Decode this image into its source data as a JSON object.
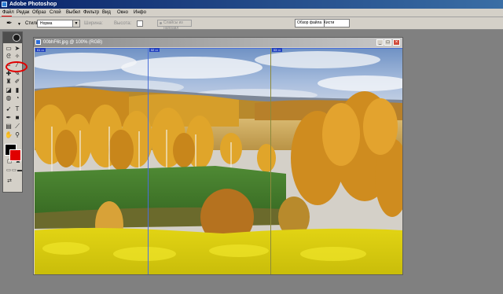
{
  "window": {
    "title": "Adobe Photoshop"
  },
  "menu": {
    "items": [
      {
        "label": "Файл"
      },
      {
        "label": "Редак"
      },
      {
        "label": "Образ"
      },
      {
        "label": "Слой"
      },
      {
        "label": "Выбел"
      },
      {
        "label": "Фильтр"
      },
      {
        "label": "Вид"
      },
      {
        "label": "Окно"
      },
      {
        "label": "Инфо"
      }
    ]
  },
  "options": {
    "tool_icon": "✒",
    "style_label": "Стиль:",
    "style_value": "Норма",
    "width_label": "Ширина:",
    "height_label": "Высота:",
    "button_label": "Слайсы из направл"
  },
  "palette_well": {
    "tabs": [
      {
        "label": "Обзор файла"
      },
      {
        "label": "Кисти"
      }
    ]
  },
  "toolbox": {
    "icons": [
      "rectangular-marquee-icon",
      "move-icon",
      "lasso-icon",
      "magic-wand-icon",
      "crop-icon",
      "slice-icon",
      "healing-brush-icon",
      "brush-icon",
      "clone-stamp-icon",
      "history-brush-icon",
      "eraser-icon",
      "gradient-icon",
      "blur-icon",
      "dodge-icon",
      "path-selection-icon",
      "type-icon",
      "pen-icon",
      "shape-icon",
      "notes-icon",
      "eyedropper-icon",
      "hand-icon",
      "zoom-icon"
    ],
    "foreground_color": "#000000",
    "background_color": "#e00000"
  },
  "document": {
    "title": "00bhF6t.jpg @ 100% (RGB)",
    "guide_tags": [
      "01 ▭",
      "02 ▭",
      "03 ▭"
    ]
  },
  "colors": {
    "accent": "#e00000",
    "guide_blue": "#4a6fd8",
    "guide_olive": "#8c8a3c"
  }
}
